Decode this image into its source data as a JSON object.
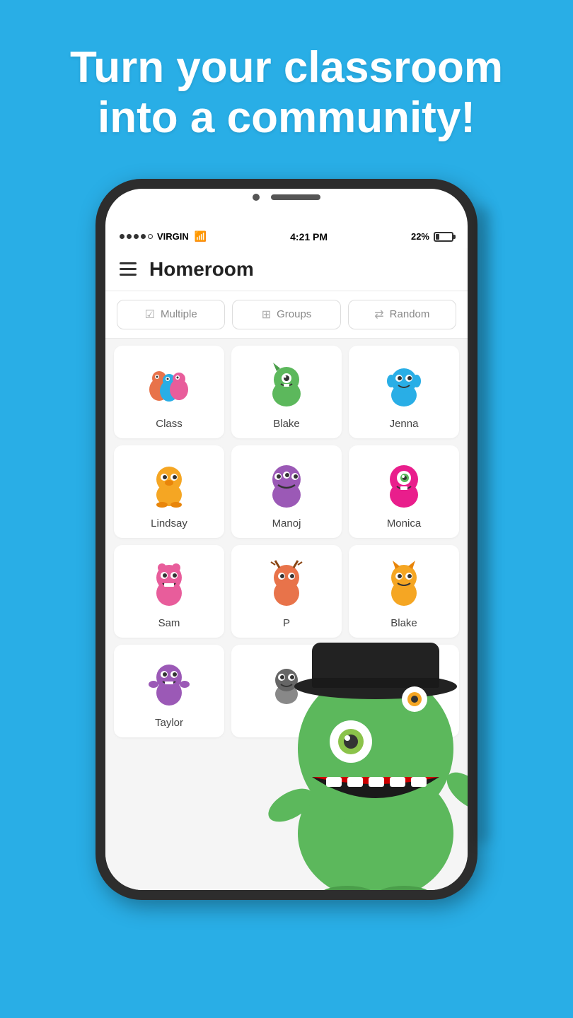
{
  "hero": {
    "line1": "Turn your classroom",
    "line2": "into a community!"
  },
  "status_bar": {
    "signal": [
      "●",
      "●",
      "●",
      "●",
      "○"
    ],
    "carrier": "VIRGIN",
    "time": "4:21 PM",
    "battery_pct": "22%"
  },
  "app": {
    "title": "Homeroom",
    "toolbar": [
      {
        "id": "multiple",
        "label": "Multiple",
        "icon": "☑"
      },
      {
        "id": "groups",
        "label": "Groups",
        "icon": "⊞"
      },
      {
        "id": "random",
        "label": "Random",
        "icon": "⇄"
      }
    ],
    "grid_items": [
      {
        "id": "class",
        "label": "Class",
        "color": "#e8734a",
        "emoji": "👾"
      },
      {
        "id": "blake1",
        "label": "Blake",
        "color": "#5cb85c",
        "emoji": "👾"
      },
      {
        "id": "jenna",
        "label": "Jenna",
        "color": "#29aee6",
        "emoji": "👾"
      },
      {
        "id": "lindsay",
        "label": "Lindsay",
        "color": "#f5a623",
        "emoji": "👾"
      },
      {
        "id": "manoj",
        "label": "Manoj",
        "color": "#9b59b6",
        "emoji": "👾"
      },
      {
        "id": "monica",
        "label": "Monica",
        "color": "#e91e8c",
        "emoji": "👾"
      },
      {
        "id": "sam",
        "label": "Sam",
        "color": "#e85d9b",
        "emoji": "👾"
      },
      {
        "id": "p",
        "label": "P",
        "color": "#e8734a",
        "emoji": "👾"
      },
      {
        "id": "blake2",
        "label": "Blake",
        "color": "#f5a623",
        "emoji": "👾"
      },
      {
        "id": "taylor",
        "label": "Taylor",
        "color": "#9b59b6",
        "emoji": "👾"
      },
      {
        "id": "unknown1",
        "label": "",
        "color": "#f5c518",
        "emoji": "👾"
      },
      {
        "id": "unknown2",
        "label": "",
        "color": "#5cb85c",
        "emoji": "👾"
      }
    ]
  }
}
